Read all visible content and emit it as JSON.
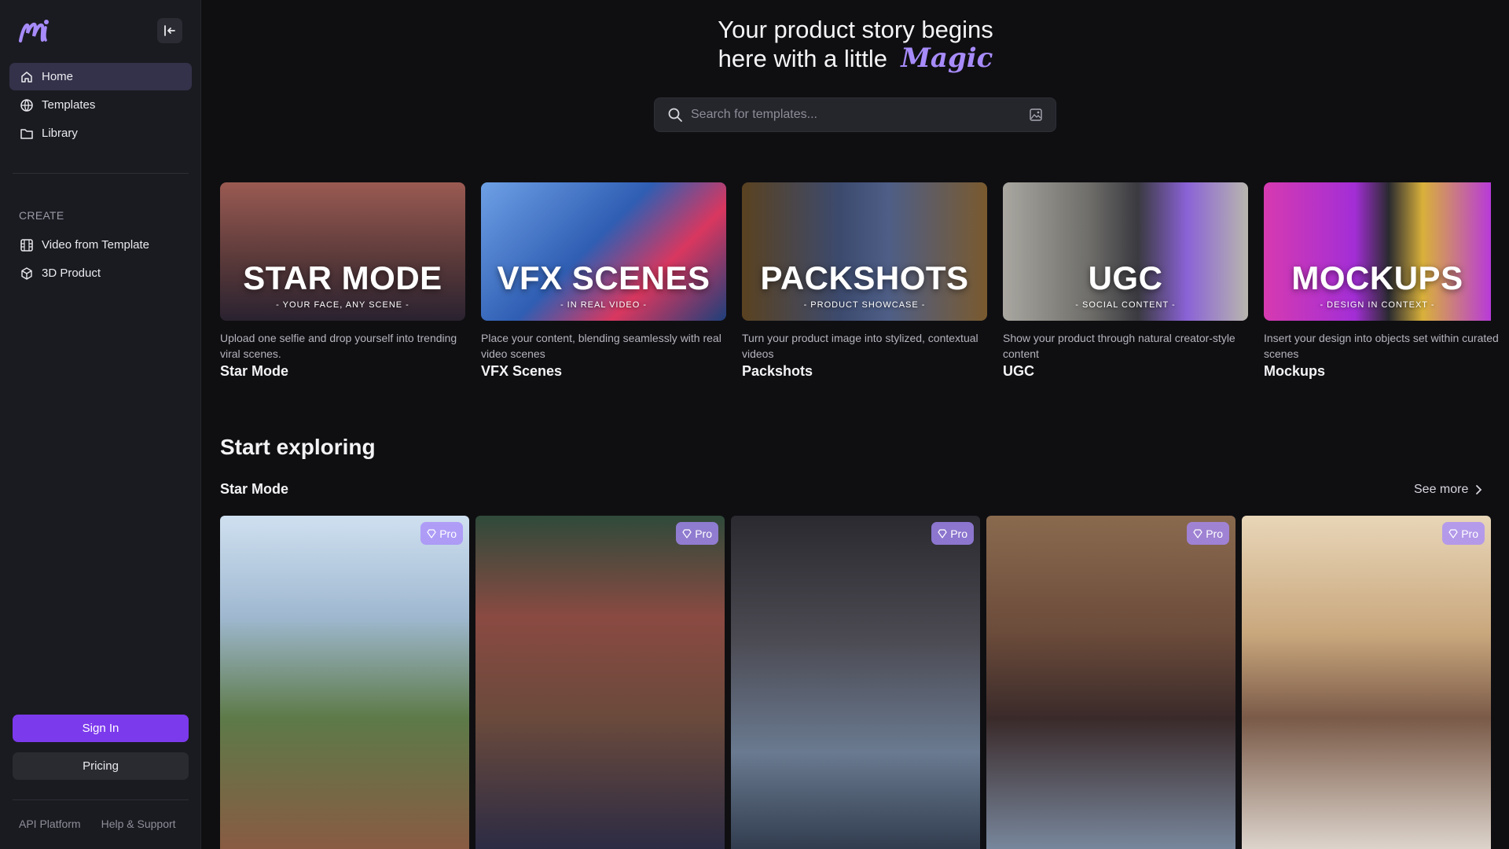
{
  "sidebar": {
    "nav": [
      {
        "label": "Home",
        "icon": "home-icon",
        "active": true
      },
      {
        "label": "Templates",
        "icon": "globe-icon"
      },
      {
        "label": "Library",
        "icon": "folder-icon"
      }
    ],
    "create_label": "CREATE",
    "create_items": [
      {
        "label": "Video from Template",
        "icon": "film-icon"
      },
      {
        "label": "3D Product",
        "icon": "cube-icon"
      }
    ],
    "signin_label": "Sign In",
    "pricing_label": "Pricing",
    "footer_links": [
      "API Platform",
      "Help & Support"
    ]
  },
  "hero": {
    "line1": "Your product story begins",
    "line2": "here with a little",
    "magic": "Magic"
  },
  "search": {
    "placeholder": "Search for templates..."
  },
  "categories": [
    {
      "title": "STAR MODE",
      "subtitle": "- YOUR FACE, ANY SCENE -",
      "desc": "Upload one selfie and drop yourself into trending viral scenes.",
      "name": "Star Mode",
      "bg": "#8a3b3b"
    },
    {
      "title": "VFX SCENES",
      "subtitle": "- IN REAL VIDEO -",
      "desc": "Place your content, blending seamlessly with real video scenes",
      "name": "VFX Scenes",
      "bg": "#3a6fc6"
    },
    {
      "title": "PACKSHOTS",
      "subtitle": "- PRODUCT SHOWCASE -",
      "desc": "Turn your product image into stylized, contextual videos",
      "name": "Packshots",
      "bg": "#7a5a2e"
    },
    {
      "title": "UGC",
      "subtitle": "- SOCIAL CONTENT -",
      "desc": "Show your product through natural creator-style content",
      "name": "UGC",
      "bg": "#8b8c88"
    },
    {
      "title": "MOCKUPS",
      "subtitle": "- DESIGN IN CONTEXT -",
      "desc": "Insert your design into objects set within curated scenes",
      "name": "Mockups",
      "bg": "#b03ad9"
    }
  ],
  "explore": {
    "title": "Start exploring",
    "row_title": "Star Mode",
    "see_more": "See more",
    "pro_label": "Pro",
    "tiles": [
      {
        "bg": "#9fb8d0"
      },
      {
        "bg": "#6a4a3c"
      },
      {
        "bg": "#3d3b40"
      },
      {
        "bg": "#6b4b3a"
      },
      {
        "bg": "#c9a77d"
      }
    ]
  }
}
